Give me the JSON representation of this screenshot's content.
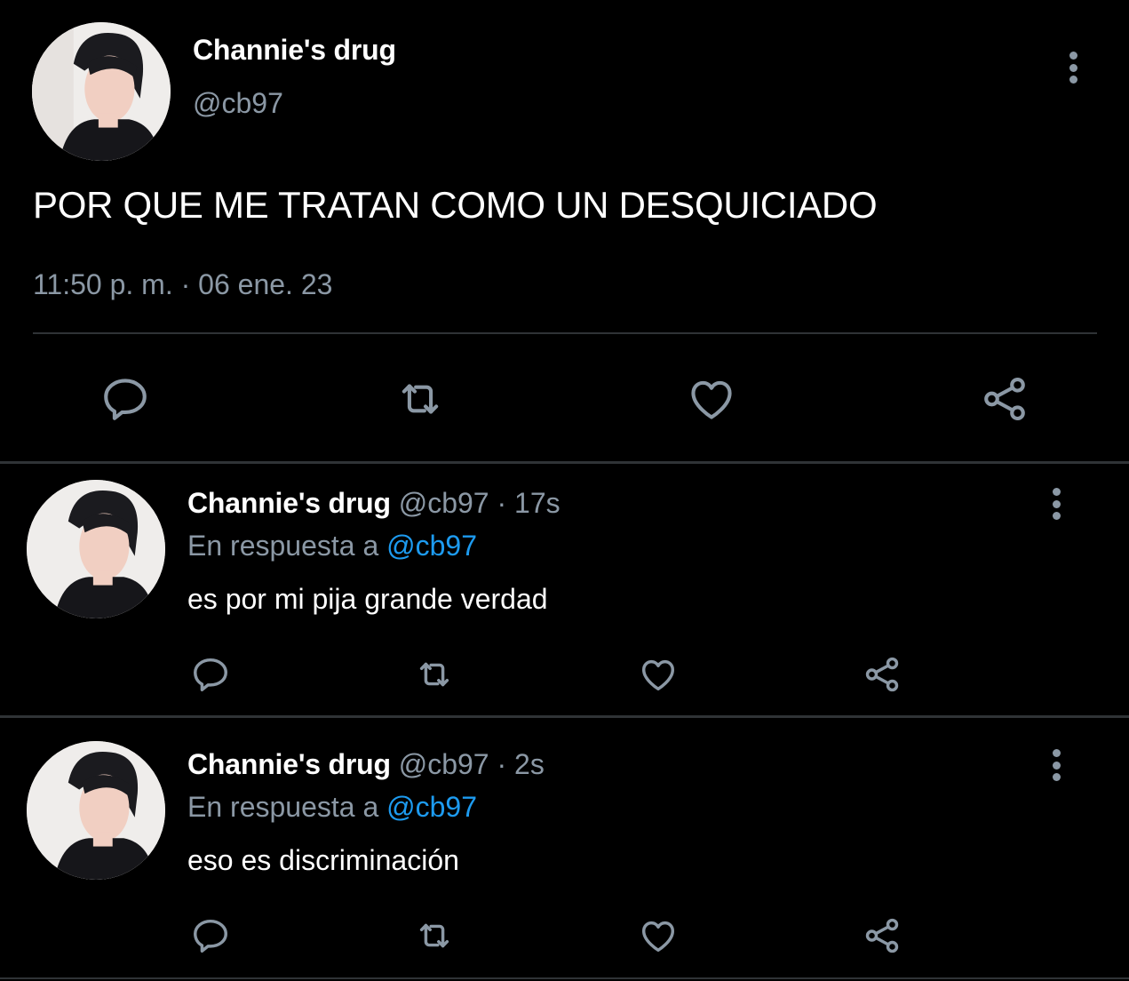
{
  "main_tweet": {
    "display_name": "Channie's drug",
    "handle": "@cb97",
    "text": "POR QUE ME TRATAN COMO UN DESQUICIADO",
    "timestamp": "11:50 p. m. · 06 ene. 23",
    "avatar_icon": "avatar-photo",
    "more_icon": "more-options-icon",
    "actions": [
      "reply-icon",
      "retweet-icon",
      "like-icon",
      "share-icon"
    ]
  },
  "replies": [
    {
      "display_name": "Channie's drug",
      "handle": "@cb97",
      "separator": "·",
      "time": "17s",
      "reply_prefix": "En respuesta a",
      "reply_to": "@cb97",
      "text": "es por mi pija grande verdad"
    },
    {
      "display_name": "Channie's drug",
      "handle": "@cb97",
      "separator": "·",
      "time": "2s",
      "reply_prefix": "En respuesta a",
      "reply_to": "@cb97",
      "text": "eso es discriminación"
    }
  ],
  "colors": {
    "background": "#000000",
    "text_primary": "#ffffff",
    "text_secondary": "#8b98a5",
    "link": "#1d9bf0",
    "divider": "#2f3336"
  }
}
